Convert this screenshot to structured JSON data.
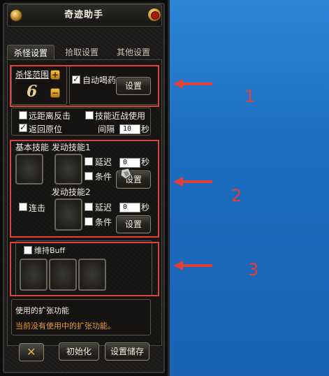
{
  "window": {
    "title": "奇迹助手"
  },
  "tabs": [
    {
      "label": "杀怪设置",
      "active": true
    },
    {
      "label": "拾取设置",
      "active": false
    },
    {
      "label": "其他设置",
      "active": false
    }
  ],
  "hunt": {
    "range_label": "杀怪范围",
    "range_value": "6",
    "plus_symbol": "+",
    "minus_symbol": "−",
    "auto_potion_label": "自动喝药",
    "auto_potion_checked": true,
    "settings_button": "设置"
  },
  "options": {
    "counter_label": "远距离反击",
    "counter_checked": false,
    "melee_skill_label": "技能近战使用",
    "melee_skill_checked": false,
    "return_label": "返回原位",
    "return_checked": true,
    "interval_label": "间隔",
    "interval_value": "10",
    "interval_unit": "秒"
  },
  "skills": {
    "basic_label": "基本技能",
    "activate1_label": "发动技能1",
    "delay1_label": "延迟",
    "delay1_value": "0",
    "delay1_unit": "秒",
    "condition1_label": "条件",
    "settings1_button": "设置",
    "combo_label": "连击",
    "activate2_label": "发动技能2",
    "delay2_label": "延迟",
    "delay2_value": "0",
    "delay2_unit": "秒",
    "condition2_label": "条件",
    "settings2_button": "设置"
  },
  "buff": {
    "label": "维持Buff"
  },
  "extension": {
    "title": "使用的扩张功能",
    "status": "当前没有使用中的扩张功能。"
  },
  "footer": {
    "init_button": "初始化",
    "save_button": "设置储存"
  },
  "annotations": [
    {
      "number": "1"
    },
    {
      "number": "2"
    },
    {
      "number": "3"
    }
  ],
  "colors": {
    "desktop": "#1f73c6",
    "annotation": "#e0403a",
    "ext_status": "#e89a2c"
  }
}
